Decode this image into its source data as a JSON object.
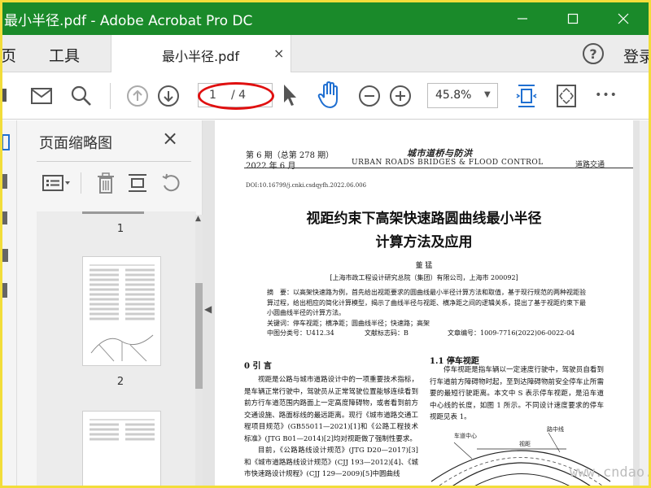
{
  "window": {
    "title": "最小半径.pdf - Adobe Acrobat Pro DC"
  },
  "menubar": {
    "home": "页",
    "tools": "工具",
    "tab_label": "最小半径.pdf",
    "tab_close": "×",
    "help": "?",
    "login": "登录"
  },
  "toolbar": {
    "current_page": "1",
    "total_pages": "/ 4",
    "zoom": "45.8%",
    "more": "•••"
  },
  "thumbnails": {
    "title": "页面缩略图",
    "close": "×",
    "pages": [
      {
        "label": "1"
      },
      {
        "label": "2"
      }
    ]
  },
  "document": {
    "issue": "第 6 期（总第 278 期）",
    "date": "2022 年 6 月",
    "journal_cn": "城市道桥与防洪",
    "journal_en": "URBAN ROADS BRIDGES & FLOOD CONTROL",
    "section": "道路交通",
    "doi": "DOI:10.16799/j.cnki.csdqyfh.2022.06.006",
    "title_line1": "视距约束下高架快速路圆曲线最小半径",
    "title_line2": "计算方法及应用",
    "author": "董  猛",
    "affiliation": "[上海市政工程设计研究总院（集团）有限公司，上海市 200092]",
    "abstract": "摘　要：以高架快速路为例，首先给出视距要求的圆曲线最小半径计算方法和取值，基于现行规范的两种视距验算过程，给出相应的简化计算模型，揭示了曲线半径与视距、横净距之间的逻辑关系，提出了基于视距约束下最小圆曲线半径的计算方法。",
    "keywords": "关键词：停车视距；横净距；圆曲线半径；快速路；高架",
    "clc": "中图分类号：U412.34",
    "doc_code": "文献标志码：B",
    "article_no": "文章编号：1009-7716(2022)06-0022-04",
    "sec0": "0  引  言",
    "para1": "视距是公路与城市道路设计中的一项重要技术指标，是车辆正常行驶中，驾驶员从正常驾驶位置能够连续看到前方行车道范围内路面上一定高度障碍物，或者看到前方交通设施、路面标线的最远距离。现行《城市道路交通工程项目规范》(GB55011—2021)[1]和《公路工程技术标准》(JTG B01—2014)[2]均对视距做了强制性要求。",
    "para2": "目前，《公路路线设计规范》(JTG D20—2017)[3]和《城市道路路线设计规范》(CJJ 193—2012)[4]、《城市快速路设计规程》(CJJ 129—2009)[5]中圆曲线",
    "sec11": "1.1  停车视距",
    "para3": "停车视距是指车辆以一定速度行驶中，驾驶员自看到行车道前方障碍物时起，至到达障碍物前安全停车止所需要的最短行驶距离。本文中 S 表示停车视距，是沿车道中心线的长度，如图 1 所示。不同设计速度要求的停车视距见表 1。",
    "fig_label_a": "车道中心",
    "fig_label_b": "视距",
    "fig_label_c": "路中线"
  },
  "watermark": "www.cndao.com"
}
